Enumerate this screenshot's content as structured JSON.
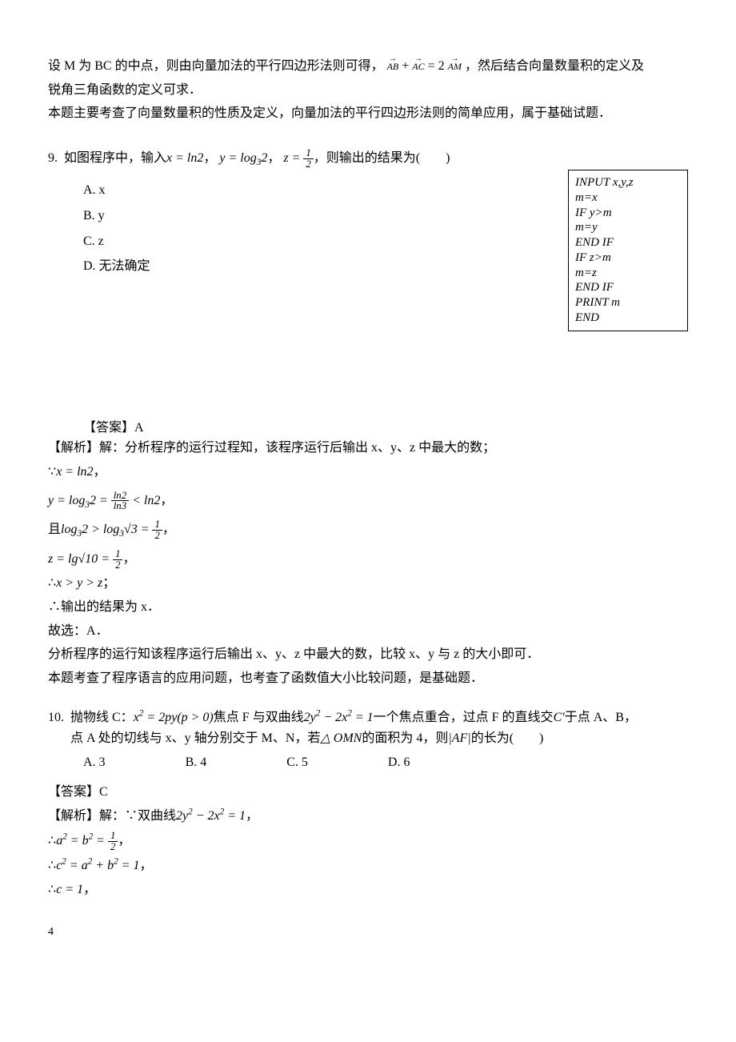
{
  "intro": {
    "line1_a": "设 M 为 BC 的中点，则由向量加法的平行四边形法则可得，",
    "line1_b": "，然后结合向量数量积的定义及",
    "line2": "锐角三角函数的定义可求．",
    "line3": "本题主要考查了向量数量积的性质及定义，向量加法的平行四边形法则的简单应用，属于基础试题．",
    "vec_ab": "AB",
    "vec_ac": "AC",
    "vec_am": "AM",
    "vec_plus": "+",
    "vec_eq": "= 2"
  },
  "q9": {
    "num": "9.",
    "prompt_a": "如图程序中，输入",
    "expr_x": "x = ln2",
    "comma1": "，",
    "expr_y": "y = log₃2",
    "comma2": "，",
    "expr_z_lhs": "z =",
    "z_num": "1",
    "z_den": "2",
    "prompt_b": "，则输出的结果为(　　)",
    "options": [
      "A. x",
      "B. y",
      "C. z",
      "D. 无法确定"
    ],
    "code": [
      "INPUT x,y,z",
      "m=x",
      "IF y>m",
      "m=y",
      "END IF",
      "IF z>m",
      "m=z",
      "END IF",
      "PRINT m",
      "END"
    ],
    "answer_label": "【答案】",
    "answer_value": "A",
    "sol_label": "【解析】",
    "sol1": "解：分析程序的运行过程知，该程序运行后输出 x、y、z 中最大的数；",
    "sol2_a": "∵",
    "sol2_b": "x = ln2",
    "sol2_c": "，",
    "sol3_a": "y = log₃2 =",
    "sol3_num": "ln2",
    "sol3_den": "ln3",
    "sol3_b": "< ln2",
    "sol3_c": "，",
    "sol4_a": "且",
    "sol4_b": "log₃2 > log₃√3 =",
    "sol4_num": "1",
    "sol4_den": "2",
    "sol4_c": "，",
    "sol5_a": "z = lg√10 =",
    "sol5_num": "1",
    "sol5_den": "2",
    "sol5_b": "，",
    "sol6_a": "∴",
    "sol6_b": "x > y > z",
    "sol6_c": "；",
    "sol7": "∴输出的结果为 x．",
    "sol8": "故选：A．",
    "sol9": "分析程序的运行知该程序运行后输出 x、y、z 中最大的数，比较 x、y 与 z 的大小即可．",
    "sol10": "本题考查了程序语言的应用问题，也考查了函数值大小比较问题，是基础题．"
  },
  "q10": {
    "num": "10.",
    "prompt_a": "抛物线 C：",
    "expr1": "x² = 2py(p > 0)",
    "prompt_b": "焦点 F 与双曲线",
    "expr2": "2y² − 2x² = 1",
    "prompt_c": "一个焦点重合，过点 F 的直线交",
    "expr3": "C′",
    "prompt_d": "于点 A、B，",
    "line2a": "点 A 处的切线与 x、y 轴分别交于 M、N，若",
    "expr4": "△ OMN",
    "line2b": "的面积为 4，则",
    "expr5": "|AF|",
    "line2c": "的长为(　　)",
    "options": [
      "A. 3",
      "B. 4",
      "C. 5",
      "D. 6"
    ],
    "answer_label": "【答案】",
    "answer_value": "C",
    "sol_label": "【解析】",
    "sol1_a": "解：∵双曲线",
    "sol1_b": "2y² − 2x² = 1",
    "sol1_c": "，",
    "sol2_a": "∴",
    "sol2_b": "a² = b² =",
    "sol2_num": "1",
    "sol2_den": "2",
    "sol2_c": "，",
    "sol3_a": "∴",
    "sol3_b": "c² = a² + b² = 1",
    "sol3_c": "，",
    "sol4_a": "∴",
    "sol4_b": "c = 1",
    "sol4_c": "，"
  },
  "page_number": "4"
}
